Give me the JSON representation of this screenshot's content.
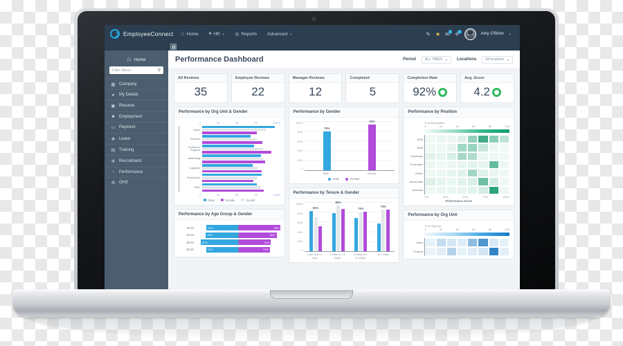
{
  "app": {
    "brand": "EmployeeConnect",
    "nav": [
      {
        "label": "Home",
        "icon": "home-icon",
        "caret": false
      },
      {
        "label": "HR",
        "icon": "briefcase-icon",
        "caret": true
      },
      {
        "label": "Reports",
        "icon": "report-icon",
        "caret": false
      },
      {
        "label": "Advanced",
        "icon": "",
        "caret": true
      }
    ],
    "toolbar": {
      "edit_icon": "pencil-icon",
      "star_icon": "star-icon",
      "message_icon": "message-icon",
      "message_count": "1",
      "notification_icon": "bell-icon",
      "notification_count": "1",
      "user_name": "Amy O'Brien"
    }
  },
  "sidebar": {
    "home_label": "Home",
    "search_placeholder": "Filter Menu",
    "items": [
      {
        "label": "Company",
        "icon": "building-icon"
      },
      {
        "label": "My Details",
        "icon": "user-icon"
      },
      {
        "label": "Resume",
        "icon": "document-icon"
      },
      {
        "label": "Employment",
        "icon": "briefcase-icon"
      },
      {
        "label": "Payment",
        "icon": "card-icon"
      },
      {
        "label": "Leave",
        "icon": "plane-icon"
      },
      {
        "label": "Training",
        "icon": "book-icon"
      },
      {
        "label": "Recruitment",
        "icon": "people-icon"
      },
      {
        "label": "Performance",
        "icon": "target-icon"
      },
      {
        "label": "OHS",
        "icon": "shield-icon"
      }
    ]
  },
  "page": {
    "title": "Performance Dashboard",
    "filters": [
      {
        "label": "Period",
        "value": "ALL TIMES"
      },
      {
        "label": "Locations",
        "value": "All locations"
      }
    ]
  },
  "kpis": [
    {
      "label": "All Reviews",
      "value": "35",
      "ring": false
    },
    {
      "label": "Employee Reviews",
      "value": "22",
      "ring": false
    },
    {
      "label": "Manager Reviews",
      "value": "12",
      "ring": false
    },
    {
      "label": "Completed",
      "value": "5",
      "ring": false
    },
    {
      "label": "Completion Rate",
      "value": "92%",
      "ring": true
    },
    {
      "label": "Avg. Score",
      "value": "4.2",
      "ring": true
    }
  ],
  "colors": {
    "male": "#33a7e0",
    "female": "#b14bdb",
    "overall": "#dfe3e7",
    "ring_green": "#2eb85c",
    "navy": "#2c3e50",
    "sidebar": "#4b5d6e"
  },
  "chart_data": [
    {
      "type": "bar",
      "title": "Performance by Org Unit & Gender",
      "orientation": "horizontal",
      "categories": [
        "Sales",
        "Finance",
        "Customer Support",
        "Marketing",
        "Logistics",
        "Production",
        "R&D"
      ],
      "series": [
        {
          "name": "Male",
          "color": "#33a7e0",
          "values": [
            93,
            62,
            67,
            75,
            65,
            76,
            70
          ]
        },
        {
          "name": "Female",
          "color": "#b14bdb",
          "values": [
            70,
            77,
            89,
            81,
            76,
            66,
            79
          ]
        },
        {
          "name": "Overall",
          "color": "#dfe3e7",
          "values": [
            82,
            70,
            78,
            78,
            71,
            71,
            75
          ]
        }
      ],
      "xticks": [
        "0",
        "25",
        "50",
        "75",
        "100%"
      ],
      "xlim": [
        0,
        100
      ],
      "legend": [
        "Male",
        "Female",
        "Overall"
      ],
      "legend_position": "bottom"
    },
    {
      "type": "bar",
      "title": "Performance by Gender",
      "orientation": "vertical",
      "categories": [
        "Male",
        "Female"
      ],
      "values": [
        78,
        92
      ],
      "data_labels": [
        "78%",
        "92%"
      ],
      "colors": [
        "#33a7e0",
        "#b14bdb"
      ],
      "yticks": [
        "100%",
        "80%",
        "60%",
        "40%",
        "20%",
        "0"
      ],
      "ylim": [
        0,
        100
      ],
      "legend": [
        "Male",
        "Female"
      ],
      "legend_position": "bottom"
    },
    {
      "type": "heatmap",
      "title": "Performance by Position",
      "legend_title": "% of Employees",
      "legend_ticks": [
        "0",
        "20",
        "40",
        "60",
        "80",
        "100"
      ],
      "colorscale": "green",
      "rows": [
        "BOD",
        "HRM",
        "Developer",
        "Consultant",
        "Admin",
        "Accountant",
        "Assistant"
      ],
      "xlabel": "Performance Score",
      "xticks": [
        "0%",
        "25%",
        "50%",
        "75%",
        "100%"
      ],
      "values": [
        [
          2,
          5,
          4,
          10,
          42,
          78,
          46,
          24
        ],
        [
          3,
          3,
          6,
          36,
          40,
          20,
          4,
          2
        ],
        [
          8,
          6,
          12,
          34,
          30,
          5,
          3,
          2
        ],
        [
          4,
          3,
          4,
          6,
          8,
          6,
          62,
          4
        ],
        [
          3,
          4,
          6,
          8,
          36,
          10,
          5,
          3
        ],
        [
          10,
          6,
          5,
          8,
          12,
          58,
          14,
          3
        ],
        [
          3,
          4,
          5,
          6,
          8,
          14,
          86,
          4
        ]
      ]
    },
    {
      "type": "bar",
      "title": "Performance by Tenure & Gender",
      "orientation": "vertical",
      "categories": [
        "Less Than 1 Year",
        "1 Year to < 3 Years",
        "3 Years to < 10 Years",
        "10+ Years"
      ],
      "data_labels": [
        "65%",
        "88%",
        "75%",
        "79%"
      ],
      "series": [
        {
          "name": "Male",
          "color": "#33a7e0",
          "values": [
            81,
            77,
            67,
            56
          ]
        },
        {
          "name": "Overall",
          "color": "#e3e7eb",
          "values": [
            68,
            92,
            78,
            84
          ]
        },
        {
          "name": "Female",
          "color": "#b14bdb",
          "values": [
            50,
            85,
            79,
            84
          ]
        }
      ],
      "yticks": [
        "100%",
        "80%",
        "60%",
        "40%",
        "20%",
        "0"
      ],
      "ylim": [
        0,
        100
      ]
    },
    {
      "type": "bar",
      "title": "Performance by Age Group & Gender",
      "orientation": "tornado",
      "categories": [
        "15-24",
        "25-34",
        "35-44",
        "45-54"
      ],
      "series": [
        {
          "name": "Male",
          "color": "#33a7e0",
          "values": [
            74,
            75,
            87,
            74
          ]
        },
        {
          "name": "Female",
          "color": "#b14bdb",
          "values": [
            98,
            88,
            74,
            72
          ]
        }
      ],
      "data_labels_male": [
        "74%",
        "75%",
        "87%",
        "74%"
      ],
      "data_labels_female": [
        "98%",
        "88%",
        "74%",
        "72%"
      ]
    },
    {
      "type": "heatmap",
      "title": "Performance by Org Unit",
      "legend_title": "% of Org Unit",
      "legend_ticks": [
        "0",
        "20",
        "40",
        "60",
        "80",
        "100"
      ],
      "colorscale": "blue",
      "rows": [
        "Sales",
        "Finance"
      ],
      "values": [
        [
          6,
          22,
          14,
          10,
          44,
          72,
          12,
          6
        ],
        [
          4,
          8,
          28,
          6,
          10,
          14,
          84,
          8
        ]
      ]
    }
  ]
}
